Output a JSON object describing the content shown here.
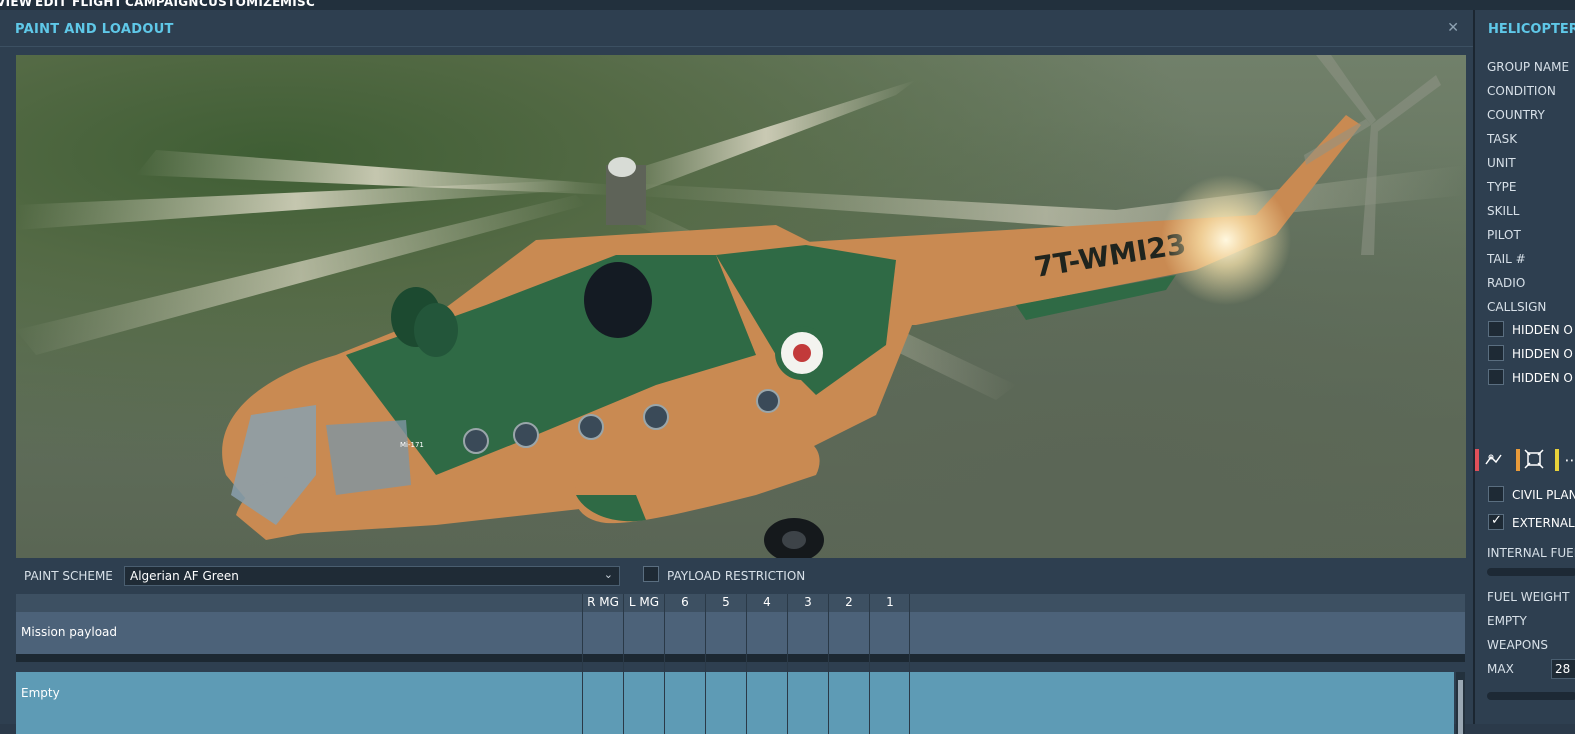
{
  "menu": [
    "VIEW",
    "EDIT",
    "FLIGHT",
    "CAMPAIGN",
    "CUSTOMIZE",
    "MISC"
  ],
  "panel": {
    "title": "PAINT AND LOADOUT",
    "close_icon": "close-icon"
  },
  "preview": {
    "aircraft_markings": "Mi-171",
    "tail_serial": "7T-WMI23"
  },
  "paint": {
    "label": "PAINT SCHEME",
    "selected": "Algerian AF Green"
  },
  "payload_restriction": {
    "label": "PAYLOAD RESTRICTION",
    "checked": false
  },
  "table": {
    "columns": [
      "R MG",
      "L MG",
      "6",
      "5",
      "4",
      "3",
      "2",
      "1"
    ],
    "rows": [
      {
        "label": "Mission payload"
      },
      {
        "label": "Empty"
      }
    ]
  },
  "right_panel": {
    "title": "HELICOPTER",
    "fields": [
      "GROUP NAME",
      "CONDITION",
      "COUNTRY",
      "TASK",
      "UNIT",
      "TYPE",
      "SKILL",
      "PILOT",
      "TAIL #",
      "RADIO",
      "CALLSIGN"
    ],
    "hidden_checks": [
      "HIDDEN O",
      "HIDDEN O",
      "HIDDEN O"
    ],
    "tabs": [
      {
        "icon": "waypoint-route-icon",
        "color": "#e0505a"
      },
      {
        "icon": "target-frame-icon",
        "color": "#e89a3a"
      },
      {
        "icon": "payload-icon",
        "color": "#e8d23a"
      }
    ],
    "civil_plane": {
      "label": "CIVIL PLAN",
      "checked": false
    },
    "external": {
      "label": "EXTERNAL",
      "checked": true
    },
    "internal_fuel": "INTERNAL FUEL",
    "fuel_weight": "FUEL WEIGHT",
    "empty": "EMPTY",
    "weapons": "WEAPONS",
    "max": "MAX",
    "max_value": "28"
  },
  "colors": {
    "accent": "#5fc8e8",
    "panel_bg": "#2e3f50",
    "row_selected": "#5e9bb5"
  }
}
